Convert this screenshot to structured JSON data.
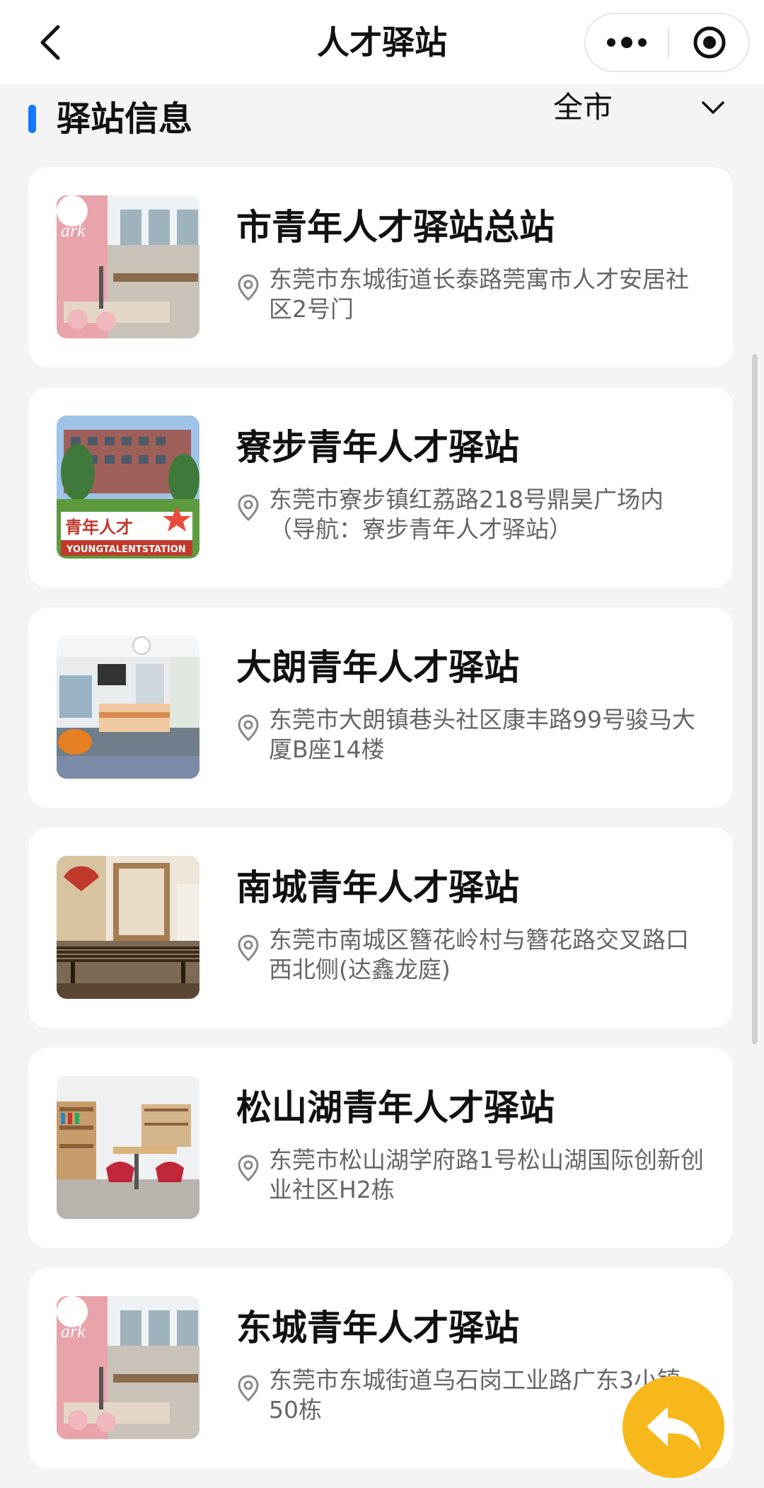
{
  "header": {
    "title": "人才驿站",
    "back_icon": "chevron-left-icon",
    "more_icon": "more-dots-icon",
    "close_icon": "target-circle-icon"
  },
  "section": {
    "title": "驿站信息",
    "accent_color": "#1677ff",
    "filter_value": "全市",
    "filter_icon": "chevron-down-icon"
  },
  "stations": [
    {
      "name": "市青年人才驿站总站",
      "address": "东莞市东城街道长泰路莞寓市人才安居社区2号门",
      "thumb": "cafe-interior"
    },
    {
      "name": "寮步青年人才驿站",
      "address": "东莞市寮步镇红荔路218号鼎昊广场内（导航：寮步青年人才驿站）",
      "thumb": "building-sign",
      "sign_text": "青年人才",
      "sign_caption": "YOUNGTALENTSTATION"
    },
    {
      "name": "大朗青年人才驿站",
      "address": "东莞市大朗镇巷头社区康丰路99号骏马大厦B座14楼",
      "thumb": "bedroom"
    },
    {
      "name": "南城青年人才驿站",
      "address": "东莞市南城区簪花岭村与簪花路交叉路口西北侧(达鑫龙庭)",
      "thumb": "guzheng-room"
    },
    {
      "name": "松山湖青年人才驿站",
      "address": "东莞市松山湖学府路1号松山湖国际创新创业社区H2栋",
      "thumb": "library"
    },
    {
      "name": "东城青年人才驿站",
      "address": "东莞市东城街道乌石岗工业路广东3小镇50栋",
      "thumb": "cafe-interior"
    }
  ],
  "fab": {
    "icon": "reply-arrow-icon",
    "color": "#f7b81c"
  }
}
